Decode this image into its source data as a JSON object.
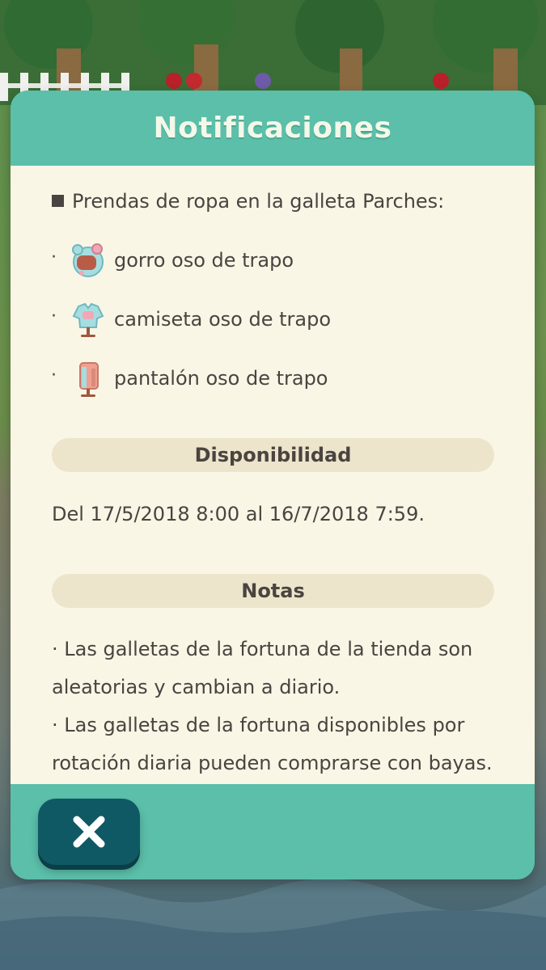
{
  "dialog": {
    "title": "Notificaciones",
    "intro": "Prendas de ropa en la galleta Parches:",
    "items": [
      {
        "bullet": "·",
        "icon": "bear-hat-icon",
        "label": "gorro oso de trapo"
      },
      {
        "bullet": "·",
        "icon": "bear-shirt-icon",
        "label": "camiseta oso de trapo"
      },
      {
        "bullet": "·",
        "icon": "bear-pants-icon",
        "label": "pantalón oso de trapo"
      }
    ],
    "availability": {
      "heading": "Disponibilidad",
      "text": "Del 17/5/2018 8:00 al 16/7/2018 7:59."
    },
    "notes": {
      "heading": "Notas",
      "lines": [
        "· Las galletas de la fortuna de la tienda son",
        "aleatorias y cambian a diario.",
        "· Las galletas de la fortuna disponibles por",
        "rotación diaria pueden comprarse con bayas."
      ]
    },
    "close_icon": "close-x-icon"
  },
  "colors": {
    "teal": "#5bbfaa",
    "cream": "#f9f6e6",
    "pill": "#ede4cc",
    "text": "#4a4440",
    "close_button": "#0f5964"
  }
}
